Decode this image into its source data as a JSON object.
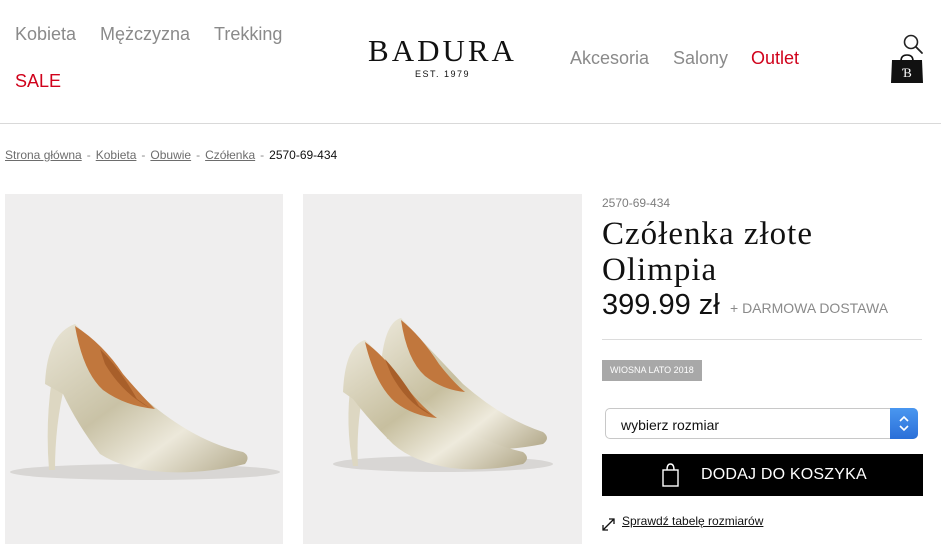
{
  "header": {
    "nav_left": [
      "Kobieta",
      "Mężczyzna",
      "Trekking"
    ],
    "sale": "SALE",
    "logo": {
      "name": "BADURA",
      "tagline": "EST. 1979"
    },
    "nav_right": [
      "Akcesoria",
      "Salony"
    ],
    "outlet": "Outlet",
    "icons": {
      "search": "search-icon",
      "bag": "shopping-bag-icon",
      "bag_text": "B"
    }
  },
  "breadcrumb": {
    "items": [
      "Strona główna",
      "Kobieta",
      "Obuwie",
      "Czółenka"
    ],
    "separator": "-",
    "current": "2570-69-434"
  },
  "product": {
    "sku": "2570-69-434",
    "title_line1": "Czółenka złote",
    "title_line2": "Olimpia",
    "price": "399.99 zł",
    "delivery": "+ DARMOWA DOSTAWA",
    "season": "WIOSNA LATO 2018",
    "size_select": "wybierz rozmiar",
    "add_to_cart": "DODAJ DO KOSZYKA",
    "size_chart_link": "Sprawdź tabelę rozmiarów"
  },
  "colors": {
    "accent_red": "#d0021b",
    "button_black": "#000000",
    "badge_grey": "#a8a8a8",
    "image_bg": "#efeeee"
  }
}
